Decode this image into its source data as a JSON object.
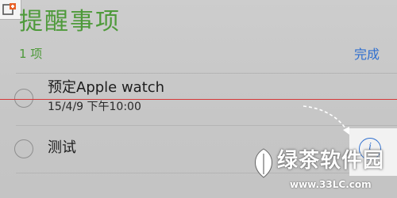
{
  "header": {
    "title": "提醒事项",
    "count": "1 项",
    "done_label": "完成"
  },
  "reminders": [
    {
      "title": "预定Apple watch",
      "subtitle": "15/4/9 下午10:00"
    },
    {
      "title": "测试",
      "subtitle": ""
    }
  ],
  "watermark": {
    "brand": "绿茶软件园",
    "url": "www.33LC.com"
  },
  "colors": {
    "title_green": "#4e9a3a",
    "done_blue": "#2f6fcf",
    "strike_red": "#d63a3a",
    "background": "#c9c9c9"
  },
  "icons": {
    "corner_logo": "app-logo-icon",
    "info": "info-icon",
    "arrow": "dashed-arrow-icon",
    "watermark_logo": "leaf-logo-icon"
  }
}
